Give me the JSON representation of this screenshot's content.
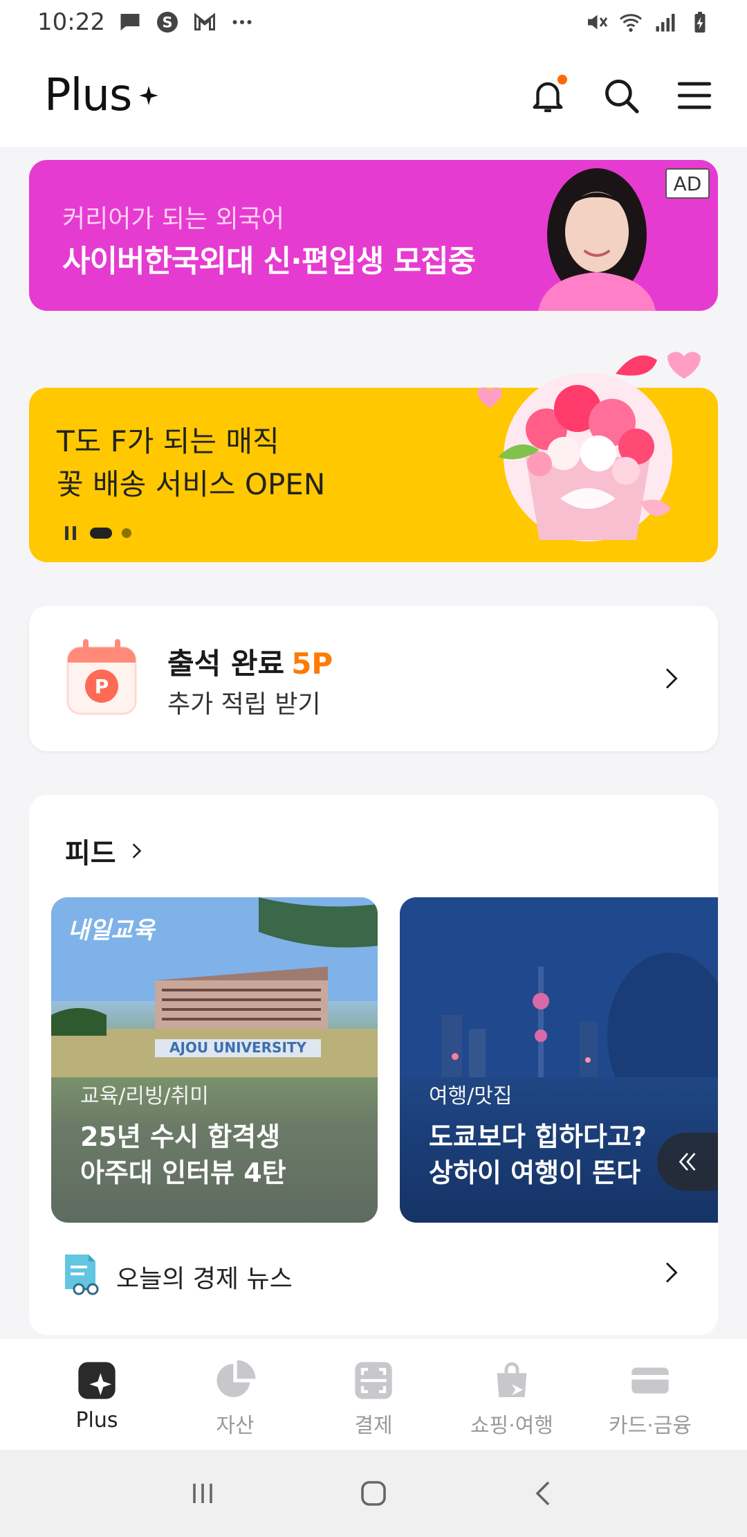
{
  "status_bar": {
    "time": "10:22",
    "left_icons": [
      "message-icon",
      "s-app-icon",
      "gmail-icon",
      "more-dots-icon"
    ],
    "right_icons": [
      "mute-icon",
      "wifi-icon",
      "signal-icon",
      "battery-icon"
    ]
  },
  "header": {
    "logo_text": "Plus",
    "actions": [
      "bell-icon",
      "search-icon",
      "menu-icon"
    ]
  },
  "ad_banner": {
    "subtitle": "커리어가 되는 외국어",
    "title": "사이버한국외대 신·편입생 모집중",
    "badge": "AD",
    "bg_color": "#e63bd0"
  },
  "promo_banner": {
    "line1": "T도 F가 되는 매직",
    "line2": "꽃 배송 서비스 OPEN",
    "bg_color": "#ffc800"
  },
  "attendance": {
    "title": "출석 완료",
    "points": "5P",
    "subtitle": "추가 적립 받기",
    "points_color": "#ff7a00"
  },
  "feed": {
    "header": "피드",
    "tiles": [
      {
        "brand": "내일교육",
        "category": "교육/리빙/취미",
        "title_line1": "25년 수시 합격생",
        "title_line2": "아주대 인터뷰 4탄"
      },
      {
        "category": "여행/맛집",
        "title_line1": "도쿄보다 힙하다고?",
        "title_line2": "상하이 여행이 뜬다"
      }
    ],
    "news_label": "오늘의 경제 뉴스"
  },
  "bottom_nav": [
    {
      "label": "Plus",
      "icon": "plus-sparkle-icon",
      "active": true
    },
    {
      "label": "자산",
      "icon": "pie-chart-icon",
      "active": false
    },
    {
      "label": "결제",
      "icon": "scan-icon",
      "active": false
    },
    {
      "label": "쇼핑·여행",
      "icon": "shopping-bag-icon",
      "active": false
    },
    {
      "label": "카드·금융",
      "icon": "card-icon",
      "active": false
    }
  ]
}
